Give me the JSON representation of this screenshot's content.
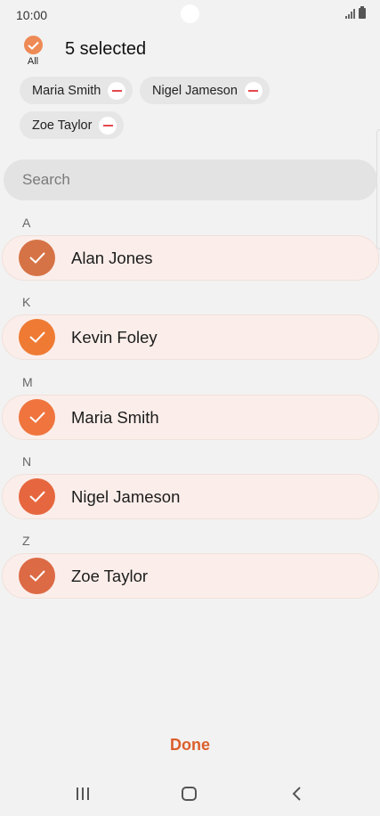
{
  "status_bar": {
    "time": "10:00",
    "icons": [
      "signal-icon",
      "battery-icon"
    ]
  },
  "header": {
    "all_label": "All",
    "selected_count": "5 selected",
    "accent_color": "#ee8a55"
  },
  "chips": [
    {
      "label": "Maria Smith"
    },
    {
      "label": "Nigel Jameson"
    },
    {
      "label": "Zoe Taylor"
    }
  ],
  "search": {
    "placeholder": "Search",
    "value": ""
  },
  "sections": [
    {
      "letter": "A",
      "contact": {
        "name": "Alan Jones",
        "avatar_color": "#d67346"
      }
    },
    {
      "letter": "K",
      "contact": {
        "name": "Kevin Foley",
        "avatar_color": "#ef7a33"
      }
    },
    {
      "letter": "M",
      "contact": {
        "name": "Maria Smith",
        "avatar_color": "#ef743d"
      }
    },
    {
      "letter": "N",
      "contact": {
        "name": "Nigel Jameson",
        "avatar_color": "#e6673f"
      }
    },
    {
      "letter": "Z",
      "contact": {
        "name": "Zoe Taylor",
        "avatar_color": "#dc6a45"
      }
    }
  ],
  "footer": {
    "done_label": "Done"
  },
  "nav_bar": {
    "icons": [
      "recent-apps-icon",
      "home-icon",
      "back-icon"
    ]
  }
}
